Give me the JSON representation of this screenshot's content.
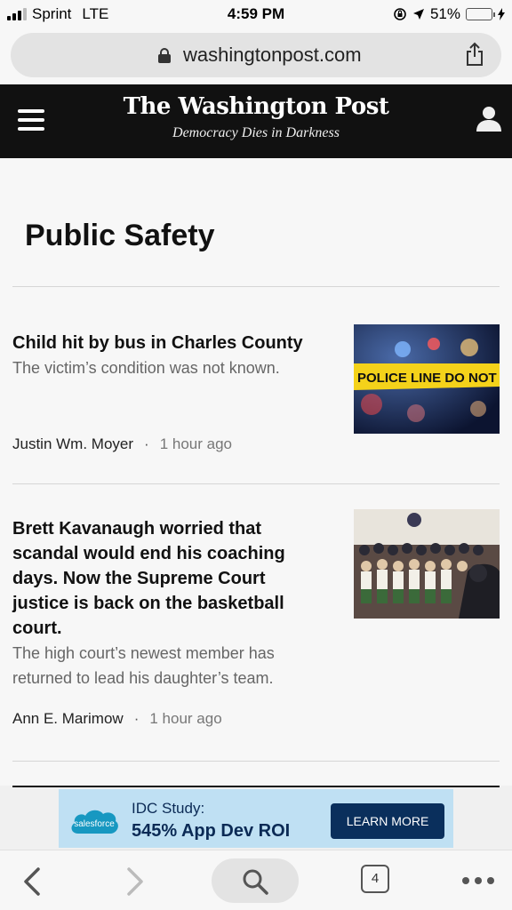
{
  "status_bar": {
    "carrier": "Sprint",
    "network": "LTE",
    "time": "4:59 PM",
    "battery_percent": "51%",
    "battery_level": 0.51
  },
  "browser": {
    "url": "washingtonpost.com",
    "open_tabs": "4"
  },
  "header": {
    "title": "The Washington Post",
    "tagline": "Democracy Dies in Darkness"
  },
  "section": {
    "title": "Public Safety"
  },
  "articles": [
    {
      "headline": "Child hit by bus in Charles County",
      "summary": "The victim’s condition was not known.",
      "author": "Justin Wm. Moyer",
      "time_ago": "1 hour ago",
      "image_caption_text": "POLICE LINE DO NOT CROSS"
    },
    {
      "headline": "Brett Kavanaugh worried that scandal would end his coaching days. Now the Supreme Court justice is back on the basketball court.",
      "summary": "The high court’s newest member has returned to lead his daughter’s team.",
      "author": "Ann E. Marimow",
      "time_ago": "1 hour ago"
    }
  ],
  "ad": {
    "brand": "salesforce",
    "line1": "IDC Study:",
    "line2": "545% App Dev ROI",
    "cta": "LEARN MORE"
  },
  "colors": {
    "header_bg": "#111111",
    "ad_bg": "#bfe0f3",
    "ad_button": "#0a2f5c",
    "battery_fill": "#f5c400"
  }
}
